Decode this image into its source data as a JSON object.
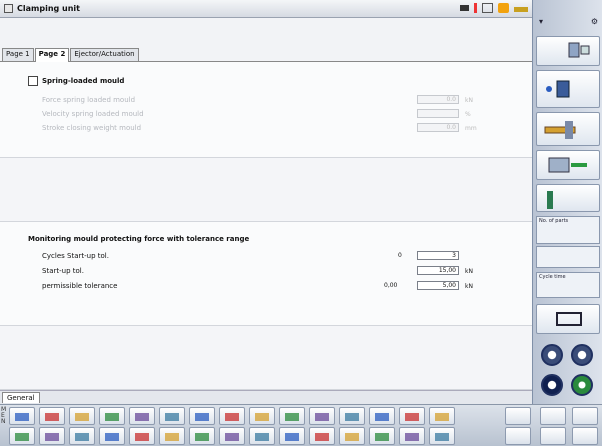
{
  "window": {
    "title": "Clamping unit"
  },
  "tabs": [
    {
      "label": "Page 1"
    },
    {
      "label": "Page 2"
    },
    {
      "label": "Ejector/Actuation"
    }
  ],
  "spring": {
    "checkbox_label": "Spring-loaded mould",
    "rows": [
      {
        "label": "Force spring loaded mould",
        "value": "0.0",
        "unit": "kN"
      },
      {
        "label": "Velocity spring loaded mould",
        "value": "",
        "unit": "%"
      },
      {
        "label": "Stroke closing weight mould",
        "value": "0.0",
        "unit": "mm"
      }
    ]
  },
  "monitoring": {
    "heading": "Monitoring mould protecting force with tolerance range",
    "rows": [
      {
        "label": "Cycles Start-up tol.",
        "actual": "0",
        "value": "3",
        "unit": ""
      },
      {
        "label": "Start-up tol.",
        "actual": "",
        "value": "15,00",
        "unit": "kN"
      },
      {
        "label": "permissible tolerance",
        "actual": "0,00",
        "value": "5,00",
        "unit": "kN"
      }
    ]
  },
  "bottom": {
    "general_tab": "General",
    "side_letters": "M\nE\nN"
  },
  "right_panel": {
    "info_labels": [
      "No. of parts",
      "Cycle time"
    ]
  },
  "colors": {
    "accent": "#203060",
    "panel": "#dde3ec"
  }
}
